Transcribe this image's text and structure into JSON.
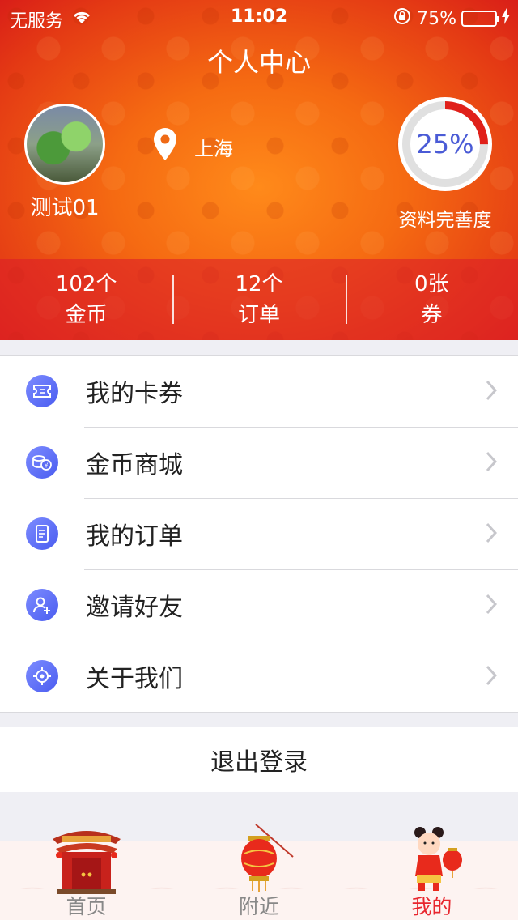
{
  "status_bar": {
    "carrier": "无服务",
    "time": "11:02",
    "battery_percent_text": "75%",
    "battery_level": 0.75
  },
  "header": {
    "title": "个人中心",
    "username": "测试01",
    "location": "上海",
    "profile_completion": {
      "value_text": "25%",
      "value": 0.25,
      "label": "资料完善度"
    }
  },
  "stats": [
    {
      "value": "102个",
      "label": "金币"
    },
    {
      "value": "12个",
      "label": "订单"
    },
    {
      "value": "0张",
      "label": "券"
    }
  ],
  "menu": [
    {
      "label": "我的卡券",
      "icon": "ticket-icon"
    },
    {
      "label": "金币商城",
      "icon": "coins-icon"
    },
    {
      "label": "我的订单",
      "icon": "order-icon"
    },
    {
      "label": "邀请好友",
      "icon": "add-friend-icon"
    },
    {
      "label": "关于我们",
      "icon": "target-icon"
    }
  ],
  "logout_label": "退出登录",
  "tabbar": [
    {
      "label": "首页",
      "icon": "temple-gate-icon",
      "active": false
    },
    {
      "label": "附近",
      "icon": "lantern-icon",
      "active": false
    },
    {
      "label": "我的",
      "icon": "fortune-child-icon",
      "active": true
    }
  ],
  "colors": {
    "header_orange": "#f56a12",
    "header_red": "#d91e18",
    "accent_blue": "#4a5bd6",
    "active_tab": "#e8262e",
    "battery_green": "#4cd964"
  }
}
